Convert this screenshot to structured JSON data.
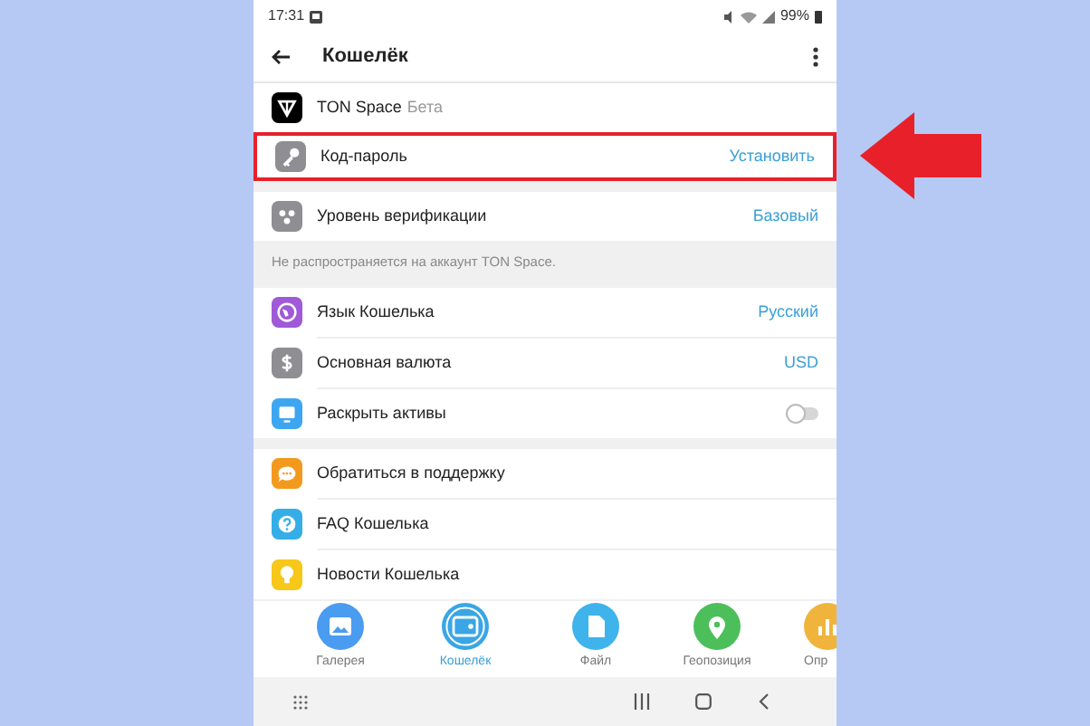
{
  "status_bar": {
    "time": "17:31",
    "battery": "99%"
  },
  "header": {
    "title": "Кошелёк"
  },
  "sections": [
    {
      "items": [
        {
          "kind": "brand",
          "label": "TON Space",
          "badge": "Бета",
          "color": "#000000",
          "highlighted": false
        },
        {
          "kind": "value",
          "label": "Код-пароль",
          "value": "Установить",
          "color": "#8e8e93",
          "highlighted": true
        }
      ]
    },
    {
      "items": [
        {
          "kind": "value",
          "label": "Уровень верификации",
          "value": "Базовый",
          "color": "#8e8e93",
          "highlighted": false
        }
      ],
      "note": "Не распространяется на аккаунт TON Space."
    },
    {
      "items": [
        {
          "kind": "value",
          "label": "Язык Кошелька",
          "value": "Русский",
          "color": "#a05ad8",
          "highlighted": false
        },
        {
          "kind": "value",
          "label": "Основная валюта",
          "value": "USD",
          "color": "#8e8e93",
          "highlighted": false
        },
        {
          "kind": "toggle",
          "label": "Раскрыть активы",
          "on": false,
          "color": "#3ea6f0",
          "highlighted": false
        }
      ]
    },
    {
      "items": [
        {
          "kind": "plain",
          "label": "Обратиться в поддержку",
          "color": "#f39a1e",
          "highlighted": false
        },
        {
          "kind": "plain",
          "label": "FAQ Кошелька",
          "color": "#35aee8",
          "highlighted": false
        },
        {
          "kind": "plain",
          "label": "Новости Кошелька",
          "color": "#f7c719",
          "highlighted": false
        }
      ]
    }
  ],
  "attach_bar": [
    {
      "label": "Галерея",
      "selected": false,
      "color": "#4a9cf0"
    },
    {
      "label": "Кошелёк",
      "selected": true,
      "color": "#3aa6e6"
    },
    {
      "label": "Файл",
      "selected": false,
      "color": "#3fb3ec"
    },
    {
      "label": "Геопозиция",
      "selected": false,
      "color": "#4cbf5b"
    },
    {
      "label": "Опр",
      "selected": false,
      "color": "#f0b43c"
    }
  ]
}
